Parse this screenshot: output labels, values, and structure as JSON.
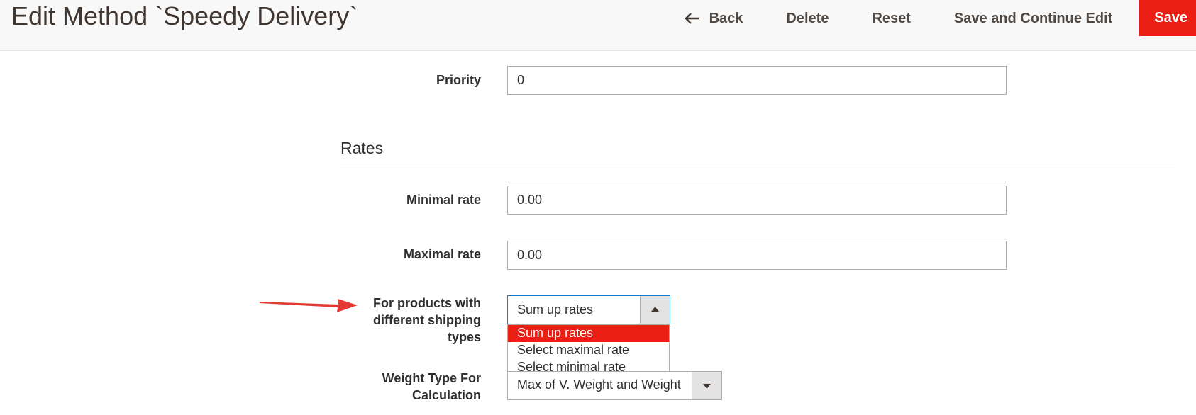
{
  "header": {
    "title": "Edit Method `Speedy Delivery`",
    "back": "Back",
    "delete": "Delete",
    "reset": "Reset",
    "save_continue": "Save and Continue Edit",
    "save": "Save"
  },
  "form": {
    "priority": {
      "label": "Priority",
      "value": "0"
    },
    "rates_section": "Rates",
    "minimal_rate": {
      "label": "Minimal rate",
      "value": "0.00"
    },
    "maximal_rate": {
      "label": "Maximal rate",
      "value": "0.00"
    },
    "shipping_types": {
      "label_line1": "For products with",
      "label_line2": "different shipping",
      "label_line3": "types",
      "selected": "Sum up rates",
      "options": [
        "Sum up rates",
        "Select maximal rate",
        "Select minimal rate"
      ]
    },
    "weight_type": {
      "label_line1": "Weight Type For",
      "label_line2": "Calculation",
      "selected": "Max of V. Weight and Weight"
    }
  },
  "colors": {
    "accent": "#eb1e13",
    "header_bg": "#f8f8f8",
    "annotation_arrow": "#e53935"
  },
  "icons": {
    "back": "arrow-left-icon",
    "select_open": "chevron-up-icon",
    "select_closed": "chevron-down-icon",
    "annotation": "pointer-arrow-icon"
  }
}
